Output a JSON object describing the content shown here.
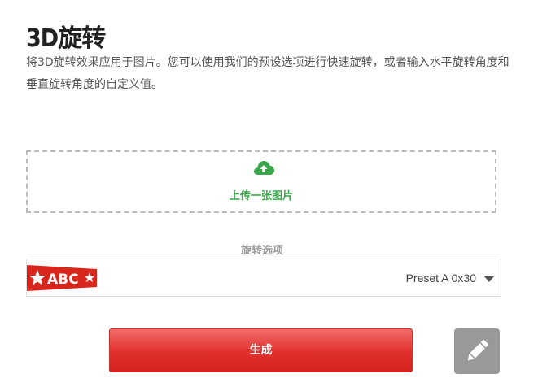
{
  "page": {
    "title": "3D旋转",
    "description": "将3D旋转效果应用于图片。您可以使用我们的预设选项进行快速旋转，或者输入水平旋转角度和垂直旋转角度的自定义值。"
  },
  "upload": {
    "label": "上传一张图片",
    "icon": "cloud-upload-icon",
    "color": "#3aa54a"
  },
  "rotation_options": {
    "label": "旋转选项",
    "selected_value": "Preset A 0x30",
    "preset_thumbnail_text": "ABC",
    "preset_thumbnail_color": "#d9261c"
  },
  "actions": {
    "generate_label": "生成",
    "generate_color": "#e0302c",
    "edit_icon": "pencil-icon"
  }
}
